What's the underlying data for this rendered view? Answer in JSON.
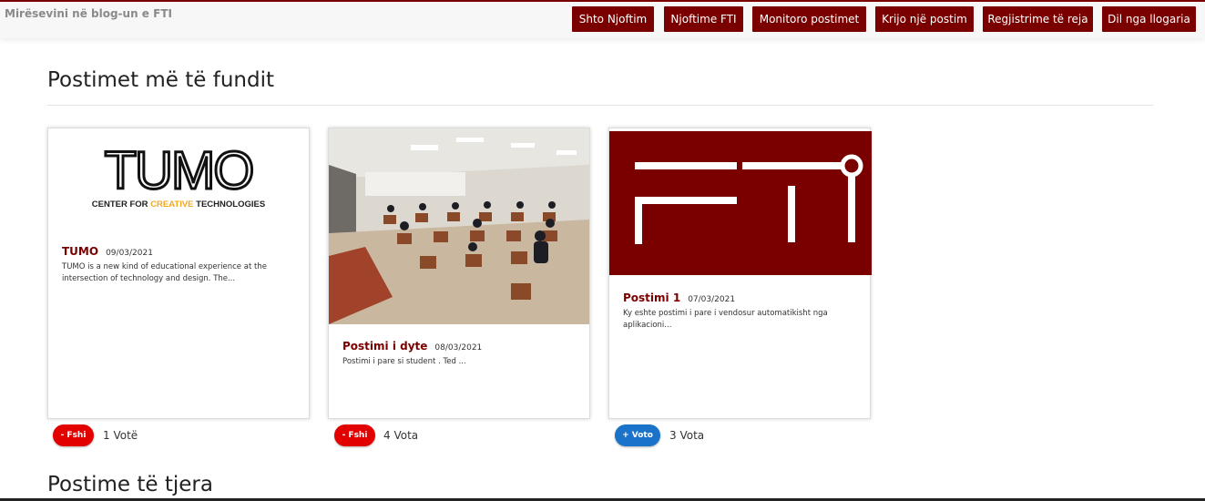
{
  "header": {
    "welcome": "Mirësevini në blog-un e FTI",
    "nav": [
      {
        "label": "Shto Njoftim"
      },
      {
        "label": "Njoftime FTI"
      },
      {
        "label": "Monitoro postimet"
      },
      {
        "label": "Krijo një postim"
      },
      {
        "label": "Regjistrime të reja"
      },
      {
        "label": "Dil nga llogaria"
      }
    ]
  },
  "main": {
    "recent_title": "Postimet më të fundit",
    "other_title": "Postime të tjera",
    "posts": [
      {
        "title": "TUMO",
        "date": "09/03/2021",
        "excerpt": "TUMO is a new kind of educational experience at the intersection of technology and design. The...",
        "logo_main": "TUMO",
        "logo_sub_left": "CENTER FOR ",
        "logo_sub_accent": "CREATIVE",
        "logo_sub_right": " TECHNOLOGIES",
        "action": "- Fshi",
        "votes": "1 Votë"
      },
      {
        "title": "Postimi i dyte",
        "date": "08/03/2021",
        "excerpt": "Postimi i pare si student . Ted ...",
        "action": "- Fshi",
        "votes": "4 Vota"
      },
      {
        "title": "Postimi 1",
        "date": "07/03/2021",
        "excerpt": "Ky eshte postimi i pare i vendosur automatikisht nga aplikacioni...",
        "action": "+ Voto",
        "votes": "3 Vota"
      }
    ]
  },
  "colors": {
    "brand": "#7a0000",
    "danger": "#e30000",
    "primary": "#1a73c9",
    "tumo_accent": "#f4a81d"
  }
}
